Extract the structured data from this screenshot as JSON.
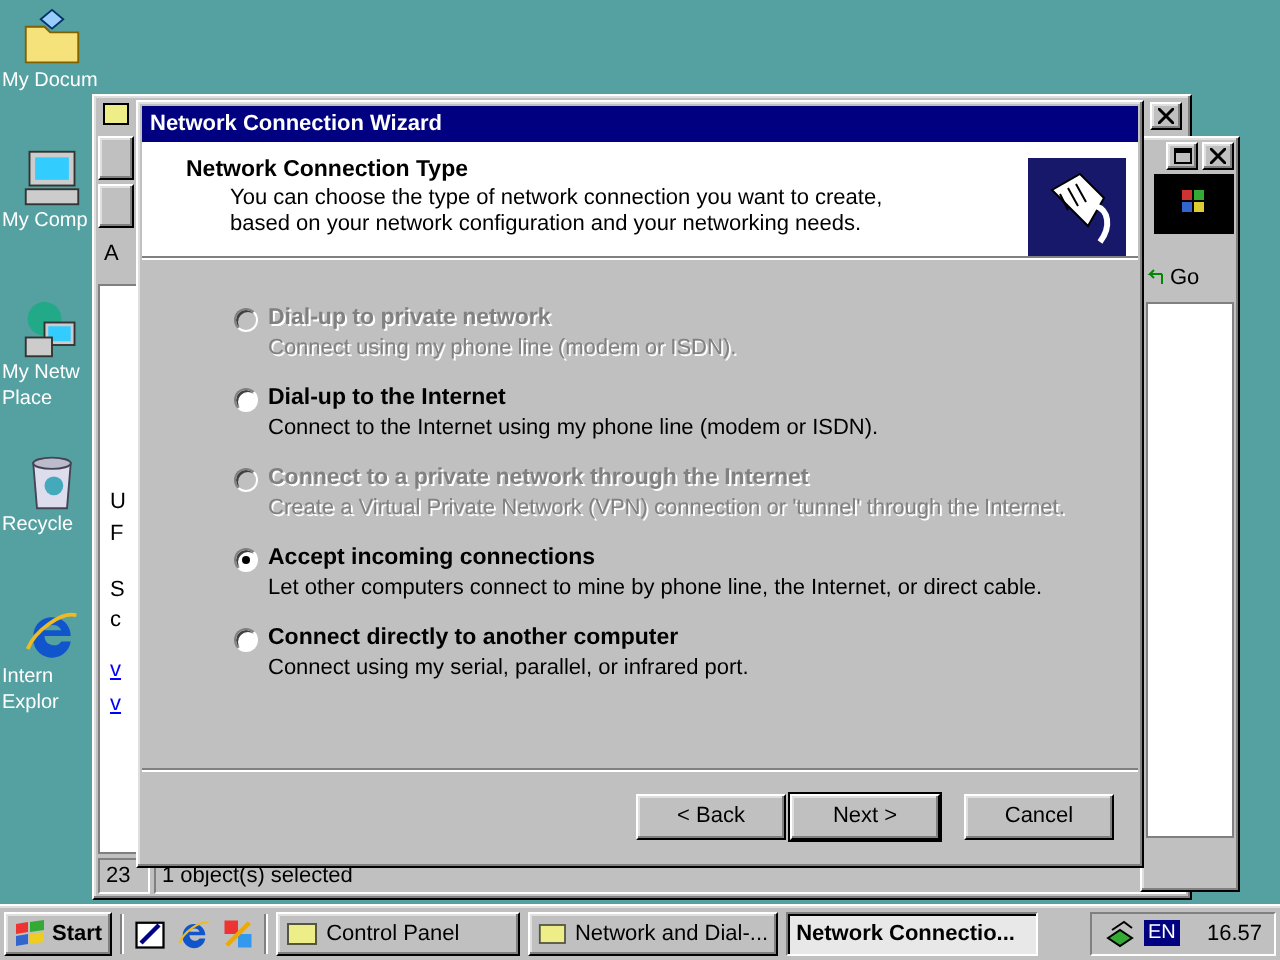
{
  "desktop_icons": [
    {
      "kind": "folder",
      "lines": [
        "My Docum"
      ]
    },
    {
      "kind": "computer",
      "lines": [
        "My Comp"
      ]
    },
    {
      "kind": "network",
      "lines": [
        "My Netw",
        "Place"
      ]
    },
    {
      "kind": "recycle",
      "lines": [
        "Recycle"
      ]
    },
    {
      "kind": "browser",
      "lines": [
        "Intern",
        "Explor"
      ]
    }
  ],
  "background_window": {
    "toolbar_letter": "A",
    "body_letters": [
      {
        "text": "U",
        "kind": "text"
      },
      {
        "text": "F",
        "kind": "text"
      },
      {
        "text": "S",
        "kind": "text"
      },
      {
        "text": "c",
        "kind": "text"
      },
      {
        "text": "v",
        "kind": "link"
      },
      {
        "text": "v",
        "kind": "link"
      }
    ],
    "status": [
      "23",
      "1 object(s) selected"
    ]
  },
  "right_window": {
    "go_button": "Go"
  },
  "wizard": {
    "title": "Network Connection Wizard",
    "header": {
      "title": "Network Connection Type",
      "subtitle": "You can choose the type of network connection you want to create, based on your network configuration and your networking needs."
    },
    "options": [
      {
        "label": "Dial-up to private network",
        "description": "Connect using my phone line (modem or ISDN).",
        "selected": false,
        "disabled": true
      },
      {
        "label": "Dial-up to the Internet",
        "description": "Connect to the Internet using my phone line (modem or ISDN).",
        "selected": false,
        "disabled": false
      },
      {
        "label": "Connect to a private network through the Internet",
        "description": "Create a Virtual Private Network (VPN) connection or 'tunnel' through the Internet.",
        "selected": false,
        "disabled": true
      },
      {
        "label": "Accept incoming connections",
        "description": "Let other computers connect to mine by phone line, the Internet, or direct cable.",
        "selected": true,
        "disabled": false
      },
      {
        "label": "Connect directly to another computer",
        "description": "Connect using my serial, parallel, or infrared port.",
        "selected": false,
        "disabled": false
      }
    ],
    "buttons": [
      {
        "label": "< Back",
        "default": false
      },
      {
        "label": "Next >",
        "default": true
      },
      {
        "label": "Cancel",
        "default": false
      }
    ]
  },
  "taskbar": {
    "start": "Start",
    "quick_launch": [
      {
        "kind": "desktop"
      },
      {
        "kind": "browser"
      },
      {
        "kind": "channels"
      }
    ],
    "tasks": [
      {
        "label": "Control Panel",
        "active": false
      },
      {
        "label": "Network and Dial-...",
        "active": false
      },
      {
        "label": "Network Connectio...",
        "active": true
      }
    ],
    "tray": {
      "language": "EN",
      "clock": "16.57"
    }
  }
}
